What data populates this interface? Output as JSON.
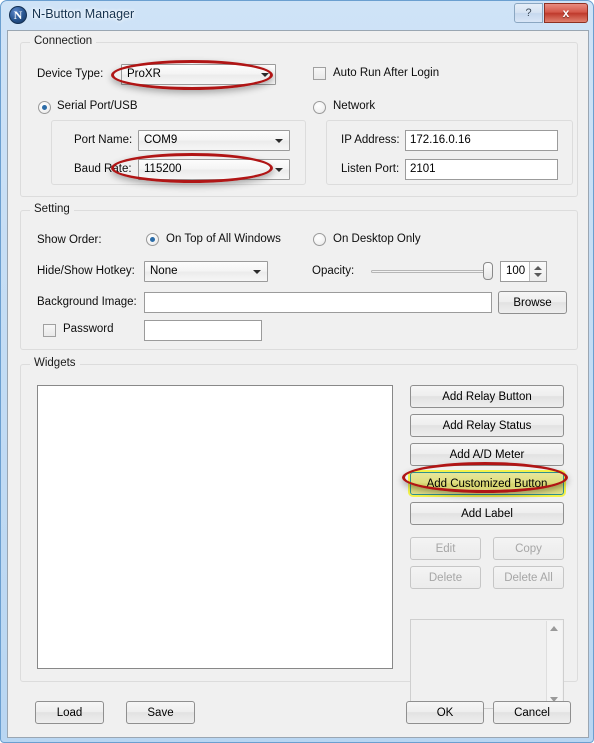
{
  "window": {
    "title": "N-Button Manager",
    "icon": "N",
    "help_label": "?",
    "close_label": "x"
  },
  "connection": {
    "title": "Connection",
    "device_type_label": "Device Type:",
    "device_type_value": "ProXR",
    "serial_radio_label": "Serial Port/USB",
    "port_name_label": "Port Name:",
    "port_name_value": "COM9",
    "baud_rate_label": "Baud Rate:",
    "baud_rate_value": "115200",
    "auto_run_label": "Auto Run After Login",
    "network_radio_label": "Network",
    "ip_address_label": "IP Address:",
    "ip_address_value": "172.16.0.16",
    "listen_port_label": "Listen Port:",
    "listen_port_value": "2101"
  },
  "setting": {
    "title": "Setting",
    "show_order_label": "Show Order:",
    "on_top_label": "On Top of All Windows",
    "on_desktop_label": "On Desktop Only",
    "hotkey_label": "Hide/Show Hotkey:",
    "hotkey_value": "None",
    "opacity_label": "Opacity:",
    "opacity_value": "100",
    "background_image_label": "Background Image:",
    "background_image_value": "",
    "browse_label": "Browse",
    "password_label": "Password",
    "password_value": ""
  },
  "widgets": {
    "title": "Widgets",
    "add_relay_button": "Add Relay Button",
    "add_relay_status": "Add Relay Status",
    "add_ad_meter": "Add A/D Meter",
    "add_customized_button": "Add Customized Button",
    "add_label": "Add Label",
    "edit": "Edit",
    "copy": "Copy",
    "delete": "Delete",
    "delete_all": "Delete All"
  },
  "footer": {
    "load": "Load",
    "save": "Save",
    "ok": "OK",
    "cancel": "Cancel"
  },
  "colors": {
    "highlight_fill": "#dedc7e",
    "highlight_outline": "#2f8f8f",
    "annotation_red": "#b01515",
    "titlebar_blue": "#c3dcf4"
  }
}
